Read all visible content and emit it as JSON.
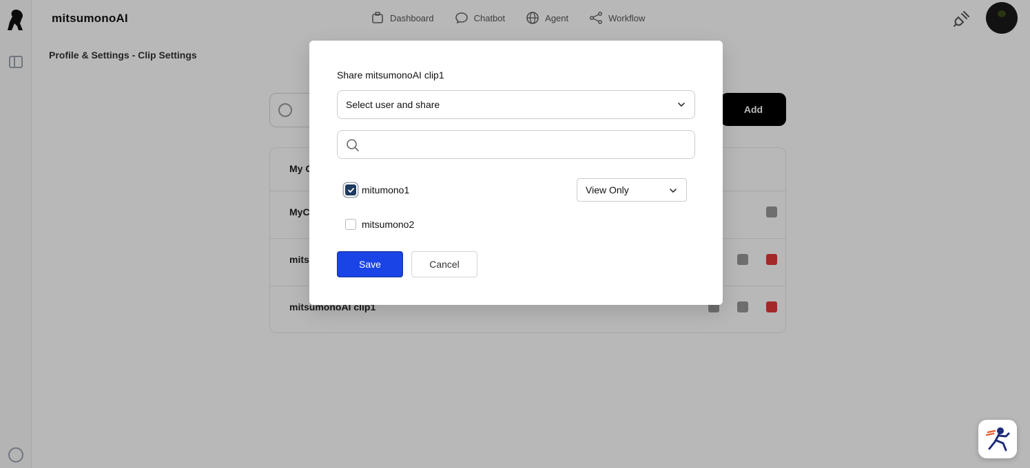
{
  "app": {
    "brand": "mitsumonoAI",
    "breadcrumb": "Profile & Settings - Clip Settings"
  },
  "nav": {
    "items": [
      {
        "label": "Dashboard",
        "icon": "dashboard-icon"
      },
      {
        "label": "Chatbot",
        "icon": "chat-icon"
      },
      {
        "label": "Agent",
        "icon": "globe-icon"
      },
      {
        "label": "Workflow",
        "icon": "workflow-icon"
      }
    ]
  },
  "background": {
    "add_label": "Add",
    "rows": [
      {
        "text": "My C"
      },
      {
        "text": "MyC"
      },
      {
        "text": "mits"
      },
      {
        "text": "mitsumonoAI clip1"
      }
    ]
  },
  "modal": {
    "title": "Share mitsumonoAI clip1",
    "user_select_value": "Select user and share",
    "search_value": "",
    "users": [
      {
        "name": "mitumono1",
        "checked": true,
        "permission": "View Only"
      },
      {
        "name": "mitsumono2",
        "checked": false
      }
    ],
    "save_label": "Save",
    "cancel_label": "Cancel"
  },
  "colors": {
    "primary": "#1a44e6",
    "checkbox_checked": "#1e3a5f",
    "danger": "#e23a3a"
  }
}
